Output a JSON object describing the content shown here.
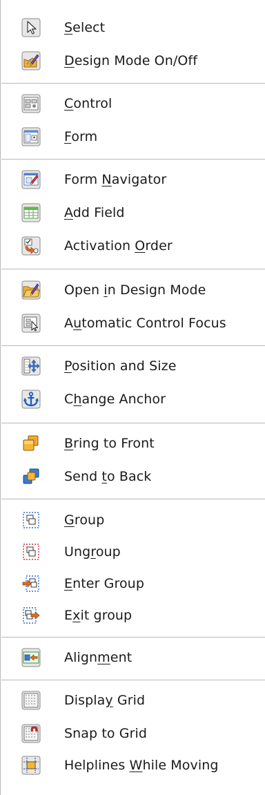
{
  "menu": {
    "items": [
      {
        "pre": "",
        "acc": "S",
        "post": "elect",
        "icon": "select-arrow-icon"
      },
      {
        "pre": "",
        "acc": "D",
        "post": "esign Mode On/Off",
        "icon": "design-mode-icon"
      },
      {
        "pre": "",
        "acc": "C",
        "post": "ontrol",
        "icon": "control-properties-icon"
      },
      {
        "pre": "",
        "acc": "F",
        "post": "orm",
        "icon": "form-properties-icon"
      },
      {
        "pre": "Form ",
        "acc": "N",
        "post": "avigator",
        "icon": "form-navigator-icon"
      },
      {
        "pre": "",
        "acc": "A",
        "post": "dd Field",
        "icon": "add-field-icon"
      },
      {
        "pre": "Activation ",
        "acc": "O",
        "post": "rder",
        "icon": "activation-order-icon"
      },
      {
        "pre": "Open ",
        "acc": "i",
        "post": "n Design Mode",
        "icon": "open-design-mode-icon"
      },
      {
        "pre": "A",
        "acc": "u",
        "post": "tomatic Control Focus",
        "icon": "auto-control-focus-icon"
      },
      {
        "pre": "",
        "acc": "P",
        "post": "osition and Size",
        "icon": "position-size-icon"
      },
      {
        "pre": "C",
        "acc": "h",
        "post": "ange Anchor",
        "icon": "anchor-icon"
      },
      {
        "pre": "",
        "acc": "B",
        "post": "ring to Front",
        "icon": "bring-to-front-icon"
      },
      {
        "pre": "Send ",
        "acc": "t",
        "post": "o Back",
        "icon": "send-to-back-icon"
      },
      {
        "pre": "",
        "acc": "G",
        "post": "roup",
        "icon": "group-icon"
      },
      {
        "pre": "Ung",
        "acc": "r",
        "post": "oup",
        "icon": "ungroup-icon"
      },
      {
        "pre": "",
        "acc": "E",
        "post": "nter Group",
        "icon": "enter-group-icon"
      },
      {
        "pre": "E",
        "acc": "x",
        "post": "it group",
        "icon": "exit-group-icon"
      },
      {
        "pre": "Align",
        "acc": "m",
        "post": "ent",
        "icon": "alignment-icon"
      },
      {
        "pre": "Displa",
        "acc": "y",
        "post": " Grid",
        "icon": "display-grid-icon"
      },
      {
        "pre": "Snap to Grid",
        "acc": "",
        "post": "",
        "icon": "snap-to-grid-icon"
      },
      {
        "pre": "Helplines ",
        "acc": "W",
        "post": "hile Moving",
        "icon": "helplines-icon"
      }
    ]
  }
}
